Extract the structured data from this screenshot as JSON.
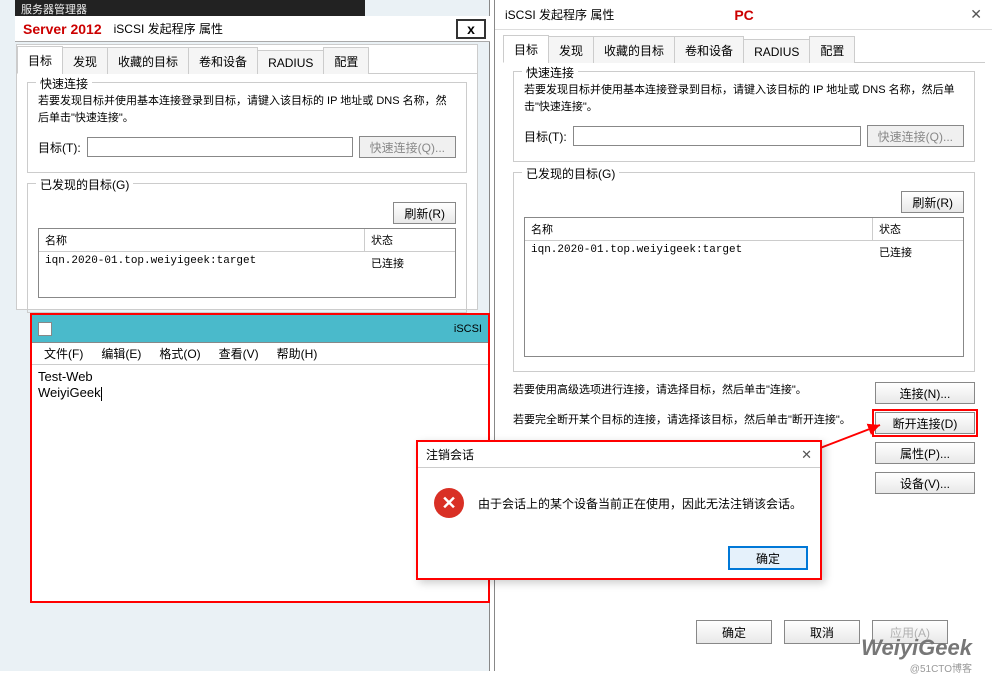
{
  "dark_bar_text": "服务器管理器",
  "server_label": "Server 2012",
  "pc_label": "PC",
  "window_title": "iSCSI 发起程序 属性",
  "close_x": "x",
  "tabs": {
    "target": "目标",
    "discover": "发现",
    "favorite": "收藏的目标",
    "vol_dev": "卷和设备",
    "radius": "RADIUS",
    "config": "配置"
  },
  "quick_connect": {
    "title": "快速连接",
    "desc": "若要发现目标并使用基本连接登录到目标，请键入该目标的 IP 地址或 DNS 名称，然后单击\"快速连接\"。",
    "target_label": "目标(T):",
    "btn": "快速连接(Q)..."
  },
  "discovered": {
    "title": "已发现的目标(G)",
    "refresh": "刷新(R)",
    "col_name": "名称",
    "col_state": "状态",
    "row_name": "iqn.2020-01.top.weiyigeek:target",
    "row_state": "已连接"
  },
  "right_actions": {
    "connect_desc": "若要使用高级选项进行连接，请选择目标，然后单击\"连接\"。",
    "connect_btn": "连接(N)...",
    "disconnect_desc": "若要完全断开某个目标的连接，请选择该目标，然后单击\"断开连接\"。",
    "disconnect_btn": "断开连接(D)",
    "props_btn": "属性(P)...",
    "devices_btn": "设备(V)..."
  },
  "notepad": {
    "title": "iSCSI",
    "menu_file": "文件(F)",
    "menu_edit": "编辑(E)",
    "menu_format": "格式(O)",
    "menu_view": "查看(V)",
    "menu_help": "帮助(H)",
    "line1": "Test-Web",
    "line2": "WeiyiGeek"
  },
  "dialog": {
    "title": "注销会话",
    "msg": "由于会话上的某个设备当前正在使用，因此无法注销该会话。",
    "ok": "确定"
  },
  "bottom": {
    "ok": "确定",
    "cancel": "取消",
    "apply": "应用(A)"
  },
  "watermark": "WeiyiGeek",
  "watermark_sub": "@51CTO博客"
}
